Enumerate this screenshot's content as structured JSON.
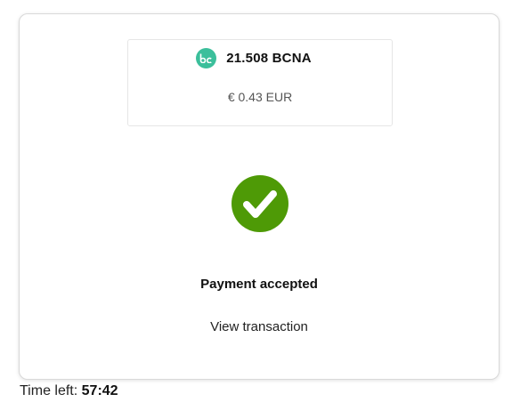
{
  "payment": {
    "coin_amount": "21.508 BCNA",
    "fiat_amount": "€ 0.43 EUR",
    "coin_icon": "bitcanna-logo-icon",
    "status": "Payment accepted",
    "status_icon": "checkmark-circle-icon",
    "view_transaction_label": "View transaction"
  },
  "timer": {
    "label": "Time left:",
    "value": "57:42"
  },
  "colors": {
    "coin_accent": "#3bbf9b",
    "success_green": "#4e9a06"
  }
}
